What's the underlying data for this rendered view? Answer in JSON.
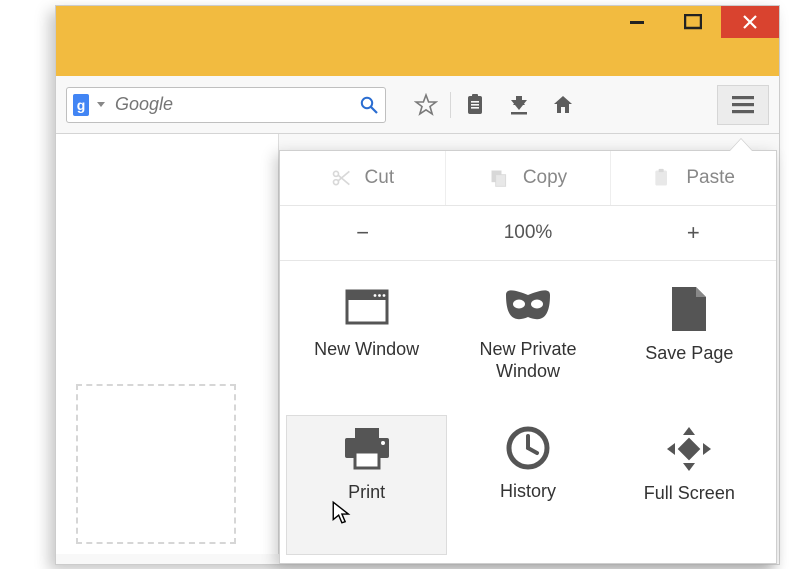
{
  "window": {
    "minimize": "—",
    "maximize": "☐",
    "close": "✕"
  },
  "search": {
    "provider_letter": "g",
    "placeholder": "Google"
  },
  "toolbar_icons": {
    "star": "star-icon",
    "clipboard": "clipboard-icon",
    "download": "download-icon",
    "home": "home-icon",
    "menu": "hamburger-icon"
  },
  "menu": {
    "edit": {
      "cut": "Cut",
      "copy": "Copy",
      "paste": "Paste"
    },
    "zoom": {
      "minus": "−",
      "value": "100%",
      "plus": "+"
    },
    "items": [
      {
        "label": "New Window"
      },
      {
        "label": "New Private\nWindow"
      },
      {
        "label": "Save Page"
      },
      {
        "label": "Print"
      },
      {
        "label": "History"
      },
      {
        "label": "Full Screen"
      }
    ]
  }
}
